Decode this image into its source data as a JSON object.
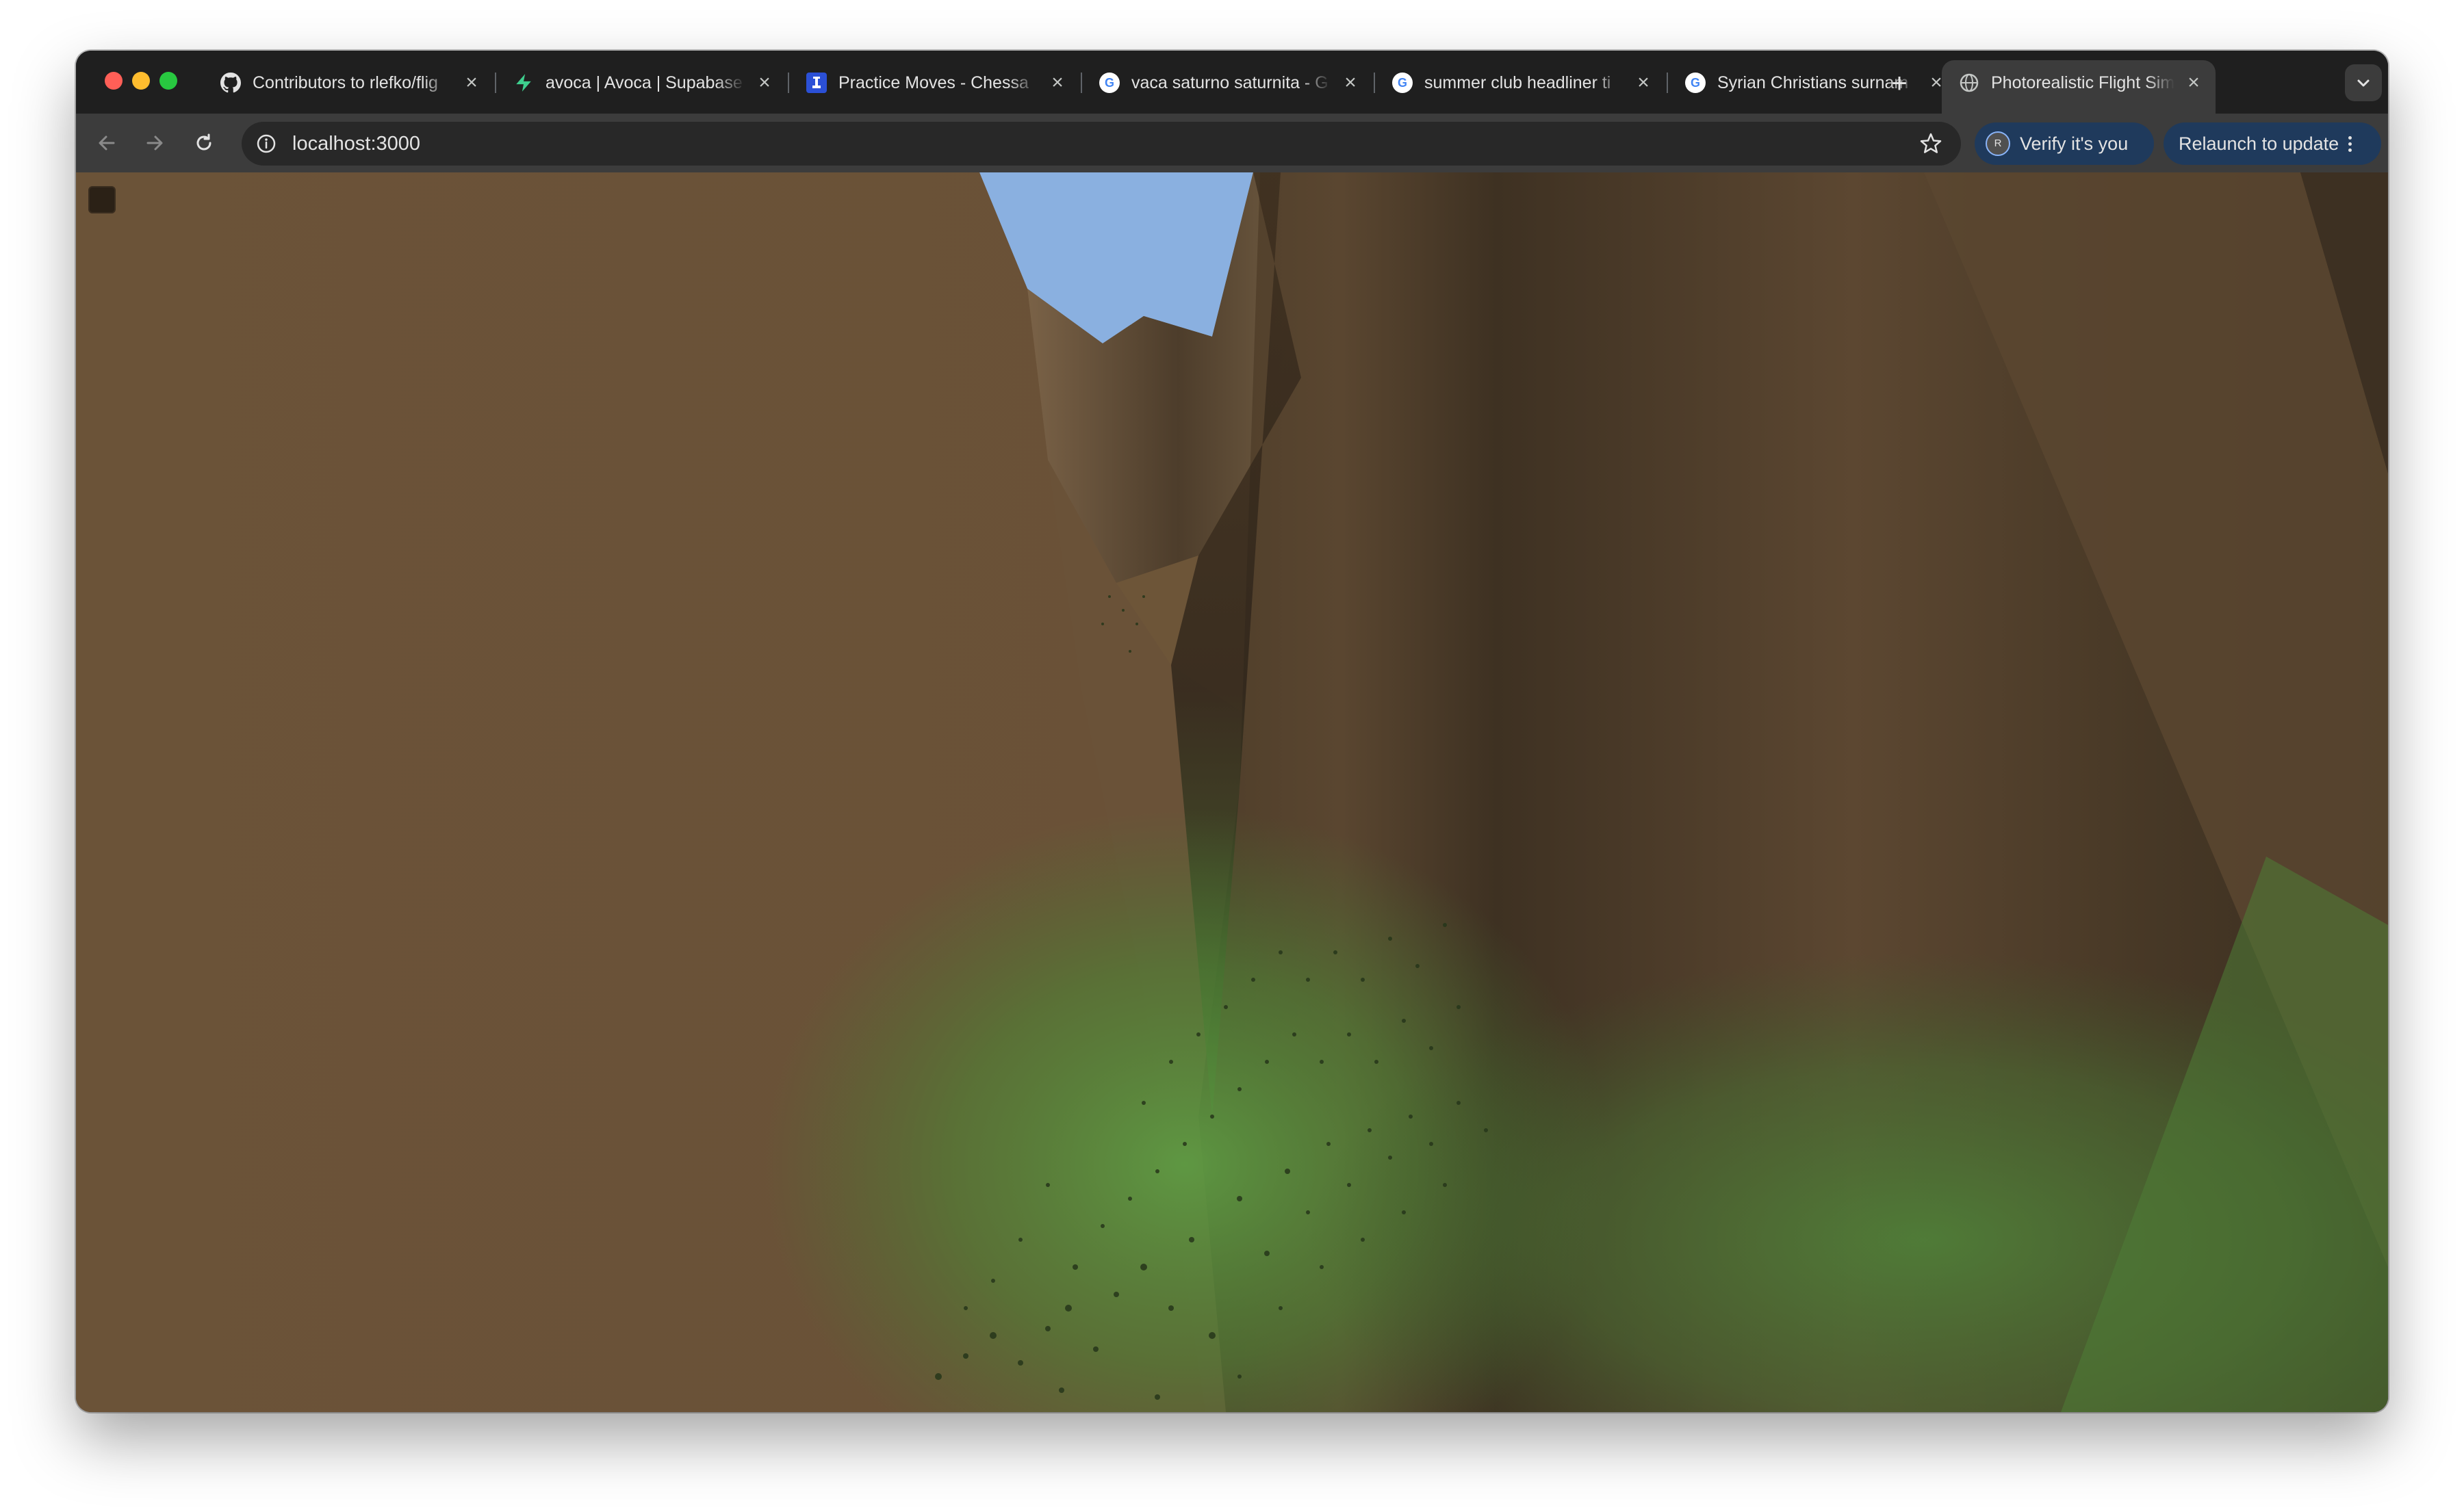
{
  "browser": {
    "tabs": [
      {
        "title": "Contributors to rlefko/flig",
        "icon": "github-icon",
        "active": false
      },
      {
        "title": "avoca | Avoca | Supabase",
        "icon": "supabase-icon",
        "active": false
      },
      {
        "title": "Practice Moves - Chessa",
        "icon": "chess-icon",
        "active": false
      },
      {
        "title": "vaca saturno saturnita - G",
        "icon": "google-icon",
        "active": false
      },
      {
        "title": "summer club headliner ti",
        "icon": "google-icon",
        "active": false
      },
      {
        "title": "Syrian Christians surnam",
        "icon": "google-icon",
        "active": false
      },
      {
        "title": "Photorealistic Flight Sim",
        "icon": "globe-icon",
        "active": true
      }
    ],
    "close_glyph": "×",
    "new_tab_glyph": "+",
    "address": {
      "url": "localhost:3000"
    },
    "profile_initial": "R",
    "verify_label": "Verify it's you",
    "relaunch_label": "Relaunch to update"
  },
  "scene": {
    "description_colors": {
      "sky": "#8ab0e0",
      "rock_left": "#6a5238",
      "rock_right": "#5e4a33",
      "rock_shadow": "#3a2d1f",
      "grass": "#5a8a3c"
    }
  }
}
